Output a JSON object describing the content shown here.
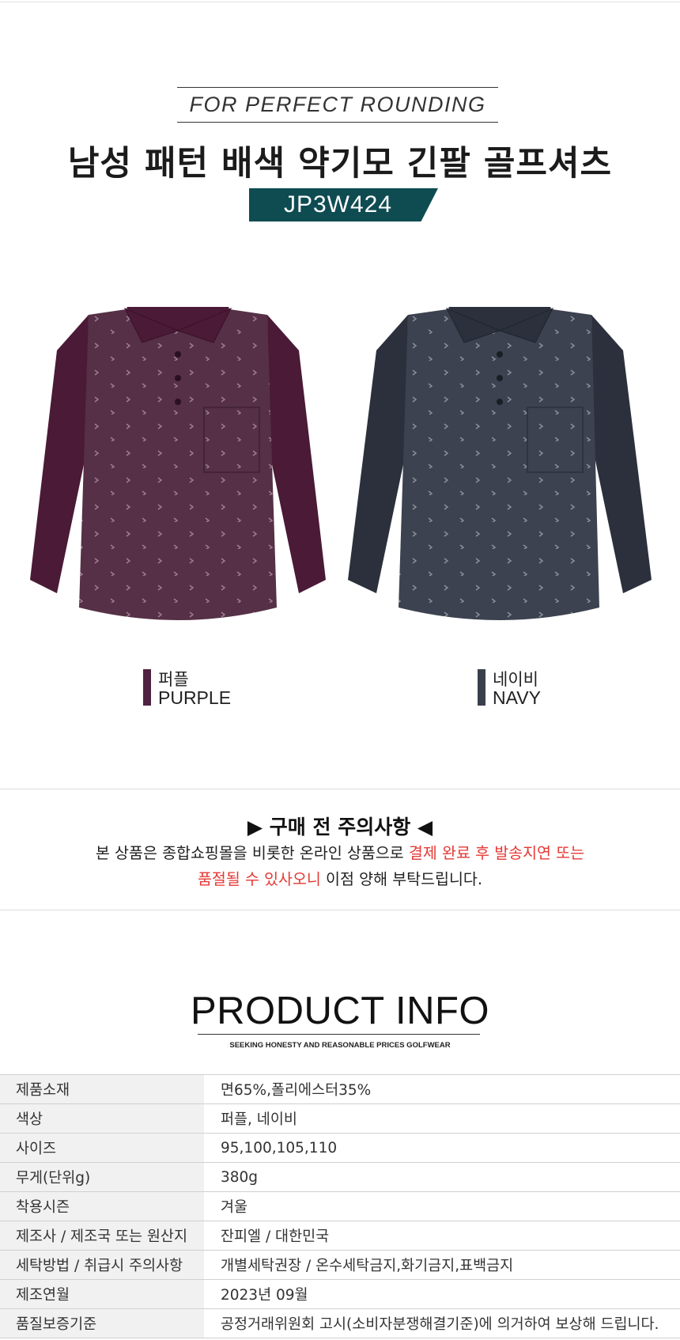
{
  "header": {
    "tagline": "FOR PERFECT ROUNDING",
    "title": "남성 패턴 배색 약기모 긴팔 골프셔츠",
    "product_code": "JP3W424"
  },
  "colors_shown": [
    {
      "kr": "퍼플",
      "en": "PURPLE",
      "color": "#4e2240"
    },
    {
      "kr": "네이비",
      "en": "NAVY",
      "color": "#3a3f4c"
    }
  ],
  "notice": {
    "title": "▶ 구매 전 주의사항 ◀",
    "line1_normal": "본 상품은 종합쇼핑몰을 비롯한 온라인 상품으로 ",
    "line1_red": "결제 완료 후 발송지연 또는",
    "line2_red": "품절될 수 있사오니",
    "line2_normal": " 이점 양해 부탁드립니다."
  },
  "product_info": {
    "title": "PRODUCT INFO",
    "subtitle": "SEEKING HONESTY AND REASONABLE PRICES GOLFWEAR",
    "rows": [
      {
        "label": "제품소재",
        "value": "면65%,폴리에스터35%"
      },
      {
        "label": "색상",
        "value": "퍼플, 네이비"
      },
      {
        "label": "사이즈",
        "value": "95,100,105,110"
      },
      {
        "label": "무게(단위g)",
        "value": "380g"
      },
      {
        "label": "착용시즌",
        "value": "겨울"
      },
      {
        "label": "제조사 / 제조국 또는 원산지",
        "value": "잔피엘 / 대한민국"
      },
      {
        "label": "세탁방법 / 취급시 주의사항",
        "value": "개별세탁권장 / 온수세탁금지,화기금지,표백금지"
      },
      {
        "label": "제조연월",
        "value": "2023년 09월"
      },
      {
        "label": "품질보증기준",
        "value": "공정거래위원회 고시(소비자분쟁해결기준)에 의거하여 보상해 드립니다."
      }
    ]
  }
}
